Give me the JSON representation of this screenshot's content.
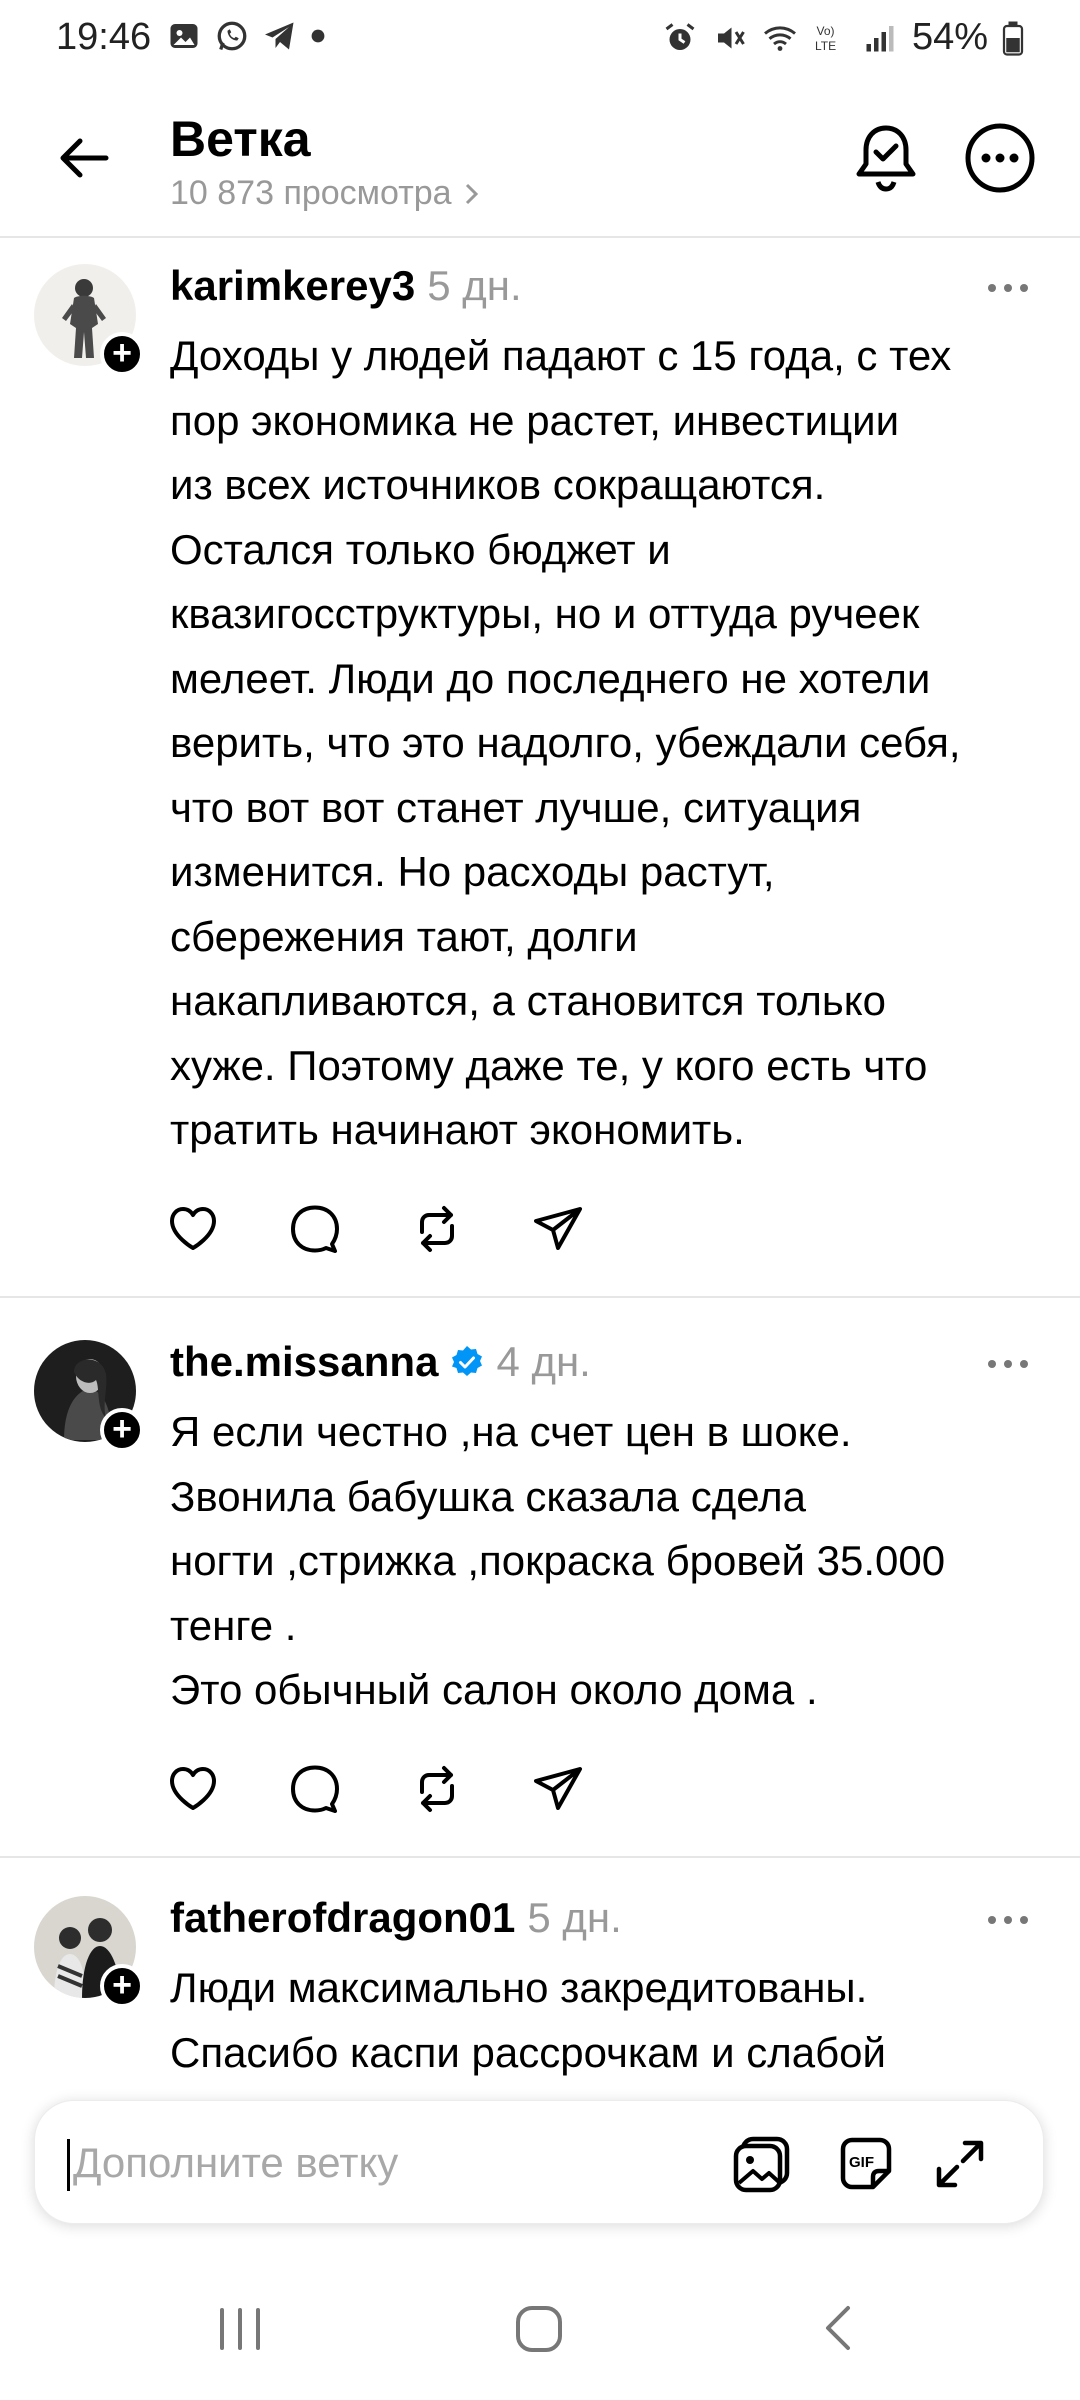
{
  "status_bar": {
    "time": "19:46",
    "battery": "54%",
    "icons": [
      "gallery-icon",
      "whatsapp-icon",
      "telegram-icon",
      "dot-icon",
      "alarm-icon",
      "mute-icon",
      "wifi-icon",
      "volte-icon",
      "signal-icon",
      "battery-icon"
    ]
  },
  "header": {
    "title": "Ветка",
    "views": "10 873 просмотра",
    "icons": [
      "back-arrow-icon",
      "bell-check-icon",
      "more-icon"
    ]
  },
  "posts": [
    {
      "username": "karimkerey3",
      "time": "5 дн.",
      "verified": false,
      "text": "Доходы у людей падают с 15 года, с тех\nпор экономика не растет, инвестиции\nиз всех источников сокращаются.\nОстался только бюджет и\nквазигосструктуры, но и оттуда ручеек\nмелеет. Люди до последнего не хотели\nверить, что это надолго, убеждали себя,\nчто вот вот станет лучше, ситуация\nизменится. Но расходы растут,\nсбережения тают, долги\nнакапливаются, а становится только\nхуже. Поэтому даже те, у кого есть что\nтратить начинают экономить."
    },
    {
      "username": "the.missanna",
      "time": "4 дн.",
      "verified": true,
      "text": "Я если честно ,на счет цен в шоке.\nЗвонила бабушка сказала сдела\nногти ,стрижка ,покраска бровей 35.000\nтенге .\nЭто обычный салон около дома ."
    },
    {
      "username": "fatherofdragon01",
      "time": "5 дн.",
      "verified": false,
      "text": "Люди максимально закредитованы.\nСпасибо каспи рассрочкам и слабой"
    }
  ],
  "composer": {
    "placeholder": "Дополните ветку",
    "icons": [
      "image-icon",
      "gif-icon",
      "expand-icon"
    ]
  },
  "colors": {
    "text": "#000000",
    "muted": "#999999",
    "divider": "#e6e6e6",
    "verified": "#0095f6"
  }
}
